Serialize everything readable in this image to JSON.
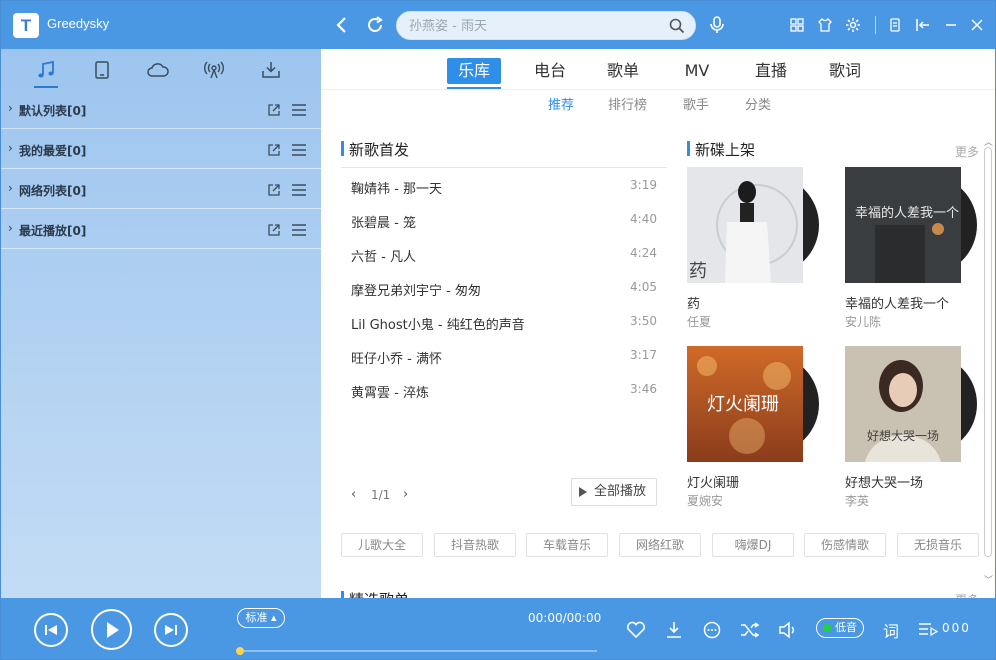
{
  "app": {
    "title": "Greedysky",
    "logo_letter": "T"
  },
  "search": {
    "placeholder": "孙燕姿 - 雨天"
  },
  "sidebar": {
    "tabs": [
      "music-note-icon",
      "device-icon",
      "cloud-icon",
      "radio-icon",
      "download-icon"
    ],
    "playlists": [
      {
        "label": "默认列表[0]"
      },
      {
        "label": "我的最爱[0]"
      },
      {
        "label": "网络列表[0]"
      },
      {
        "label": "最近播放[0]"
      }
    ]
  },
  "main": {
    "nav_tabs": [
      "乐库",
      "电台",
      "歌单",
      "MV",
      "直播",
      "歌词"
    ],
    "active_tab": "乐库",
    "sub_tabs": [
      "推荐",
      "排行榜",
      "歌手",
      "分类"
    ],
    "active_sub_tab": "推荐",
    "new_songs": {
      "title": "新歌首发",
      "songs": [
        {
          "name": "鞠婧祎 - 那一天",
          "duration": "3:19"
        },
        {
          "name": "张碧晨 - 笼",
          "duration": "4:40"
        },
        {
          "name": "六哲 - 凡人",
          "duration": "4:24"
        },
        {
          "name": "摩登兄弟刘宇宁 - 匆匆",
          "duration": "4:05"
        },
        {
          "name": "Lil Ghost小鬼 - 纯红色的声音",
          "duration": "3:50"
        },
        {
          "name": "旺仔小乔 - 满怀",
          "duration": "3:17"
        },
        {
          "name": "黄霄雲 - 淬炼",
          "duration": "3:46"
        }
      ],
      "pager": "1/1",
      "play_all": "全部播放"
    },
    "new_albums": {
      "title": "新碟上架",
      "more": "更多",
      "albums": [
        {
          "title": "药",
          "artist": "任夏",
          "cover_text": "药"
        },
        {
          "title": "幸福的人差我一个",
          "artist": "安儿陈",
          "cover_text": "幸福的人差我一个"
        },
        {
          "title": "灯火阑珊",
          "artist": "夏婉安",
          "cover_text": "灯火阑珊"
        },
        {
          "title": "好想大哭一场",
          "artist": "李英",
          "cover_text": "好想大哭一场"
        }
      ]
    },
    "tags": [
      "儿歌大全",
      "抖音热歌",
      "车载音乐",
      "网络红歌",
      "嗨爆DJ",
      "伤感情歌",
      "无损音乐"
    ],
    "featured": {
      "title": "精选歌单",
      "more": "更多"
    }
  },
  "player": {
    "quality": "标准",
    "time": "00:00/00:00",
    "progress": 0,
    "low_quality": "低音",
    "lyric": "词",
    "count": "000"
  },
  "colors": {
    "accent": "#2e8ee8",
    "bar": "#4a97e3"
  }
}
